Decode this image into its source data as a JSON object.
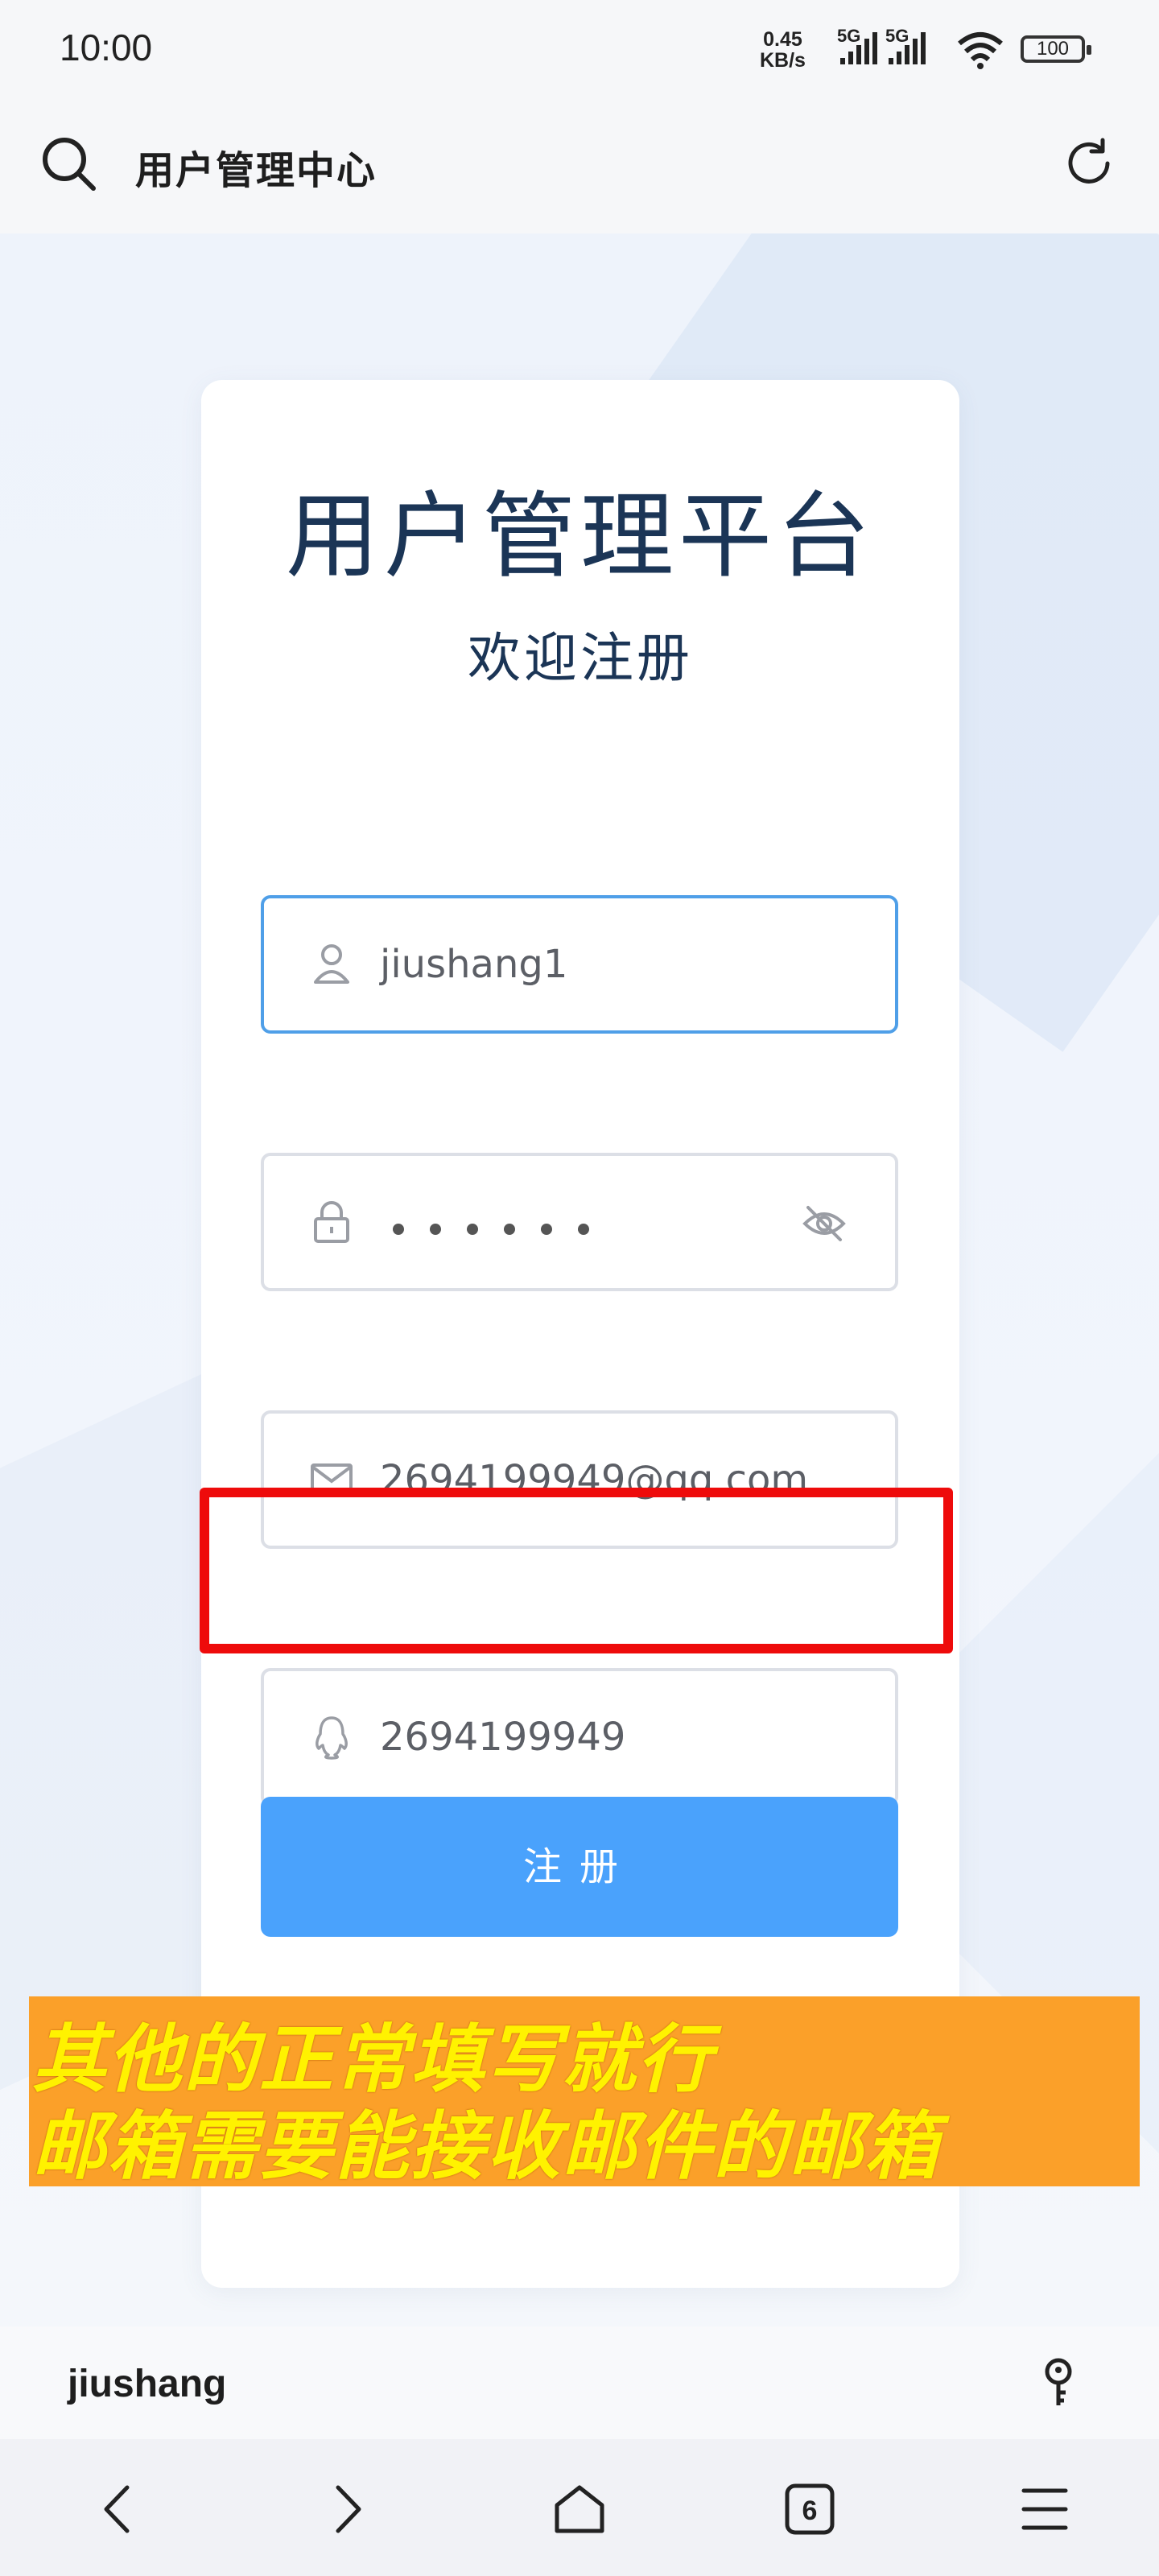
{
  "status_bar": {
    "time": "10:00",
    "net_speed_value": "0.45",
    "net_speed_unit": "KB/s",
    "signal1_label": "5G",
    "signal2_label": "5G",
    "battery": "100"
  },
  "browser": {
    "title": "用户管理中心",
    "site_name": "jiushang",
    "tab_count": "6"
  },
  "card": {
    "title": "用户管理平台",
    "subtitle": "欢迎注册"
  },
  "form": {
    "username_value": "jiushang1",
    "password_dots": 6,
    "email_value": "2694199949@qq.com",
    "qq_value": "2694199949",
    "register_label": "注册"
  },
  "annotation": {
    "line1": "其他的正常填写就行",
    "line2": "邮箱需要能接收邮件的邮箱"
  },
  "colors": {
    "accent": "#4aa2fc",
    "title": "#1b3556",
    "highlight": "#ee0b0b",
    "annotation_bg": "#fba029",
    "annotation_text": "#fff200"
  }
}
